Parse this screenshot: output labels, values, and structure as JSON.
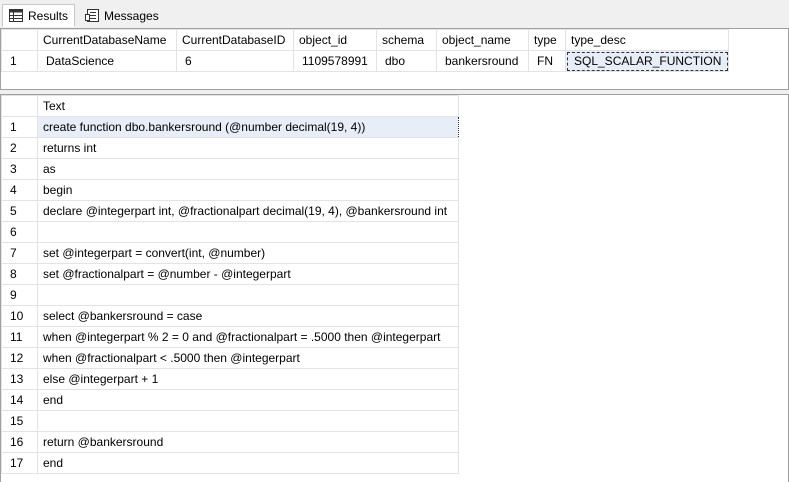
{
  "tabs": [
    {
      "label": "Results",
      "icon": "results-grid-icon",
      "active": true
    },
    {
      "label": "Messages",
      "icon": "messages-icon",
      "active": false
    }
  ],
  "result1": {
    "columns": [
      "CurrentDatabaseName",
      "CurrentDatabaseID",
      "object_id",
      "schema",
      "object_name",
      "type",
      "type_desc"
    ],
    "rows": [
      {
        "num": "1",
        "cells": [
          "DataScience",
          "6",
          "1109578991",
          "dbo",
          "bankersround",
          "FN",
          "SQL_SCALAR_FUNCTION"
        ]
      }
    ]
  },
  "result2": {
    "column": "Text",
    "rows": [
      {
        "num": "1",
        "text": "create function dbo.bankersround (@number decimal(19, 4))"
      },
      {
        "num": "2",
        "text": "returns int"
      },
      {
        "num": "3",
        "text": "as"
      },
      {
        "num": "4",
        "text": "begin"
      },
      {
        "num": "5",
        "text": "  declare @integerpart int, @fractionalpart decimal(19, 4), @bankersround int"
      },
      {
        "num": "6",
        "text": ""
      },
      {
        "num": "7",
        "text": "  set @integerpart = convert(int, @number)"
      },
      {
        "num": "8",
        "text": "  set @fractionalpart = @number - @integerpart"
      },
      {
        "num": "9",
        "text": ""
      },
      {
        "num": "10",
        "text": "select @bankersround = case"
      },
      {
        "num": "11",
        "text": "    when @integerpart % 2 = 0 and @fractionalpart = .5000 then @integerpart"
      },
      {
        "num": "12",
        "text": "    when @fractionalpart < .5000 then @integerpart"
      },
      {
        "num": "13",
        "text": "    else @integerpart + 1"
      },
      {
        "num": "14",
        "text": "end"
      },
      {
        "num": "15",
        "text": ""
      },
      {
        "num": "16",
        "text": "return @bankersround"
      },
      {
        "num": "17",
        "text": "end"
      }
    ]
  }
}
